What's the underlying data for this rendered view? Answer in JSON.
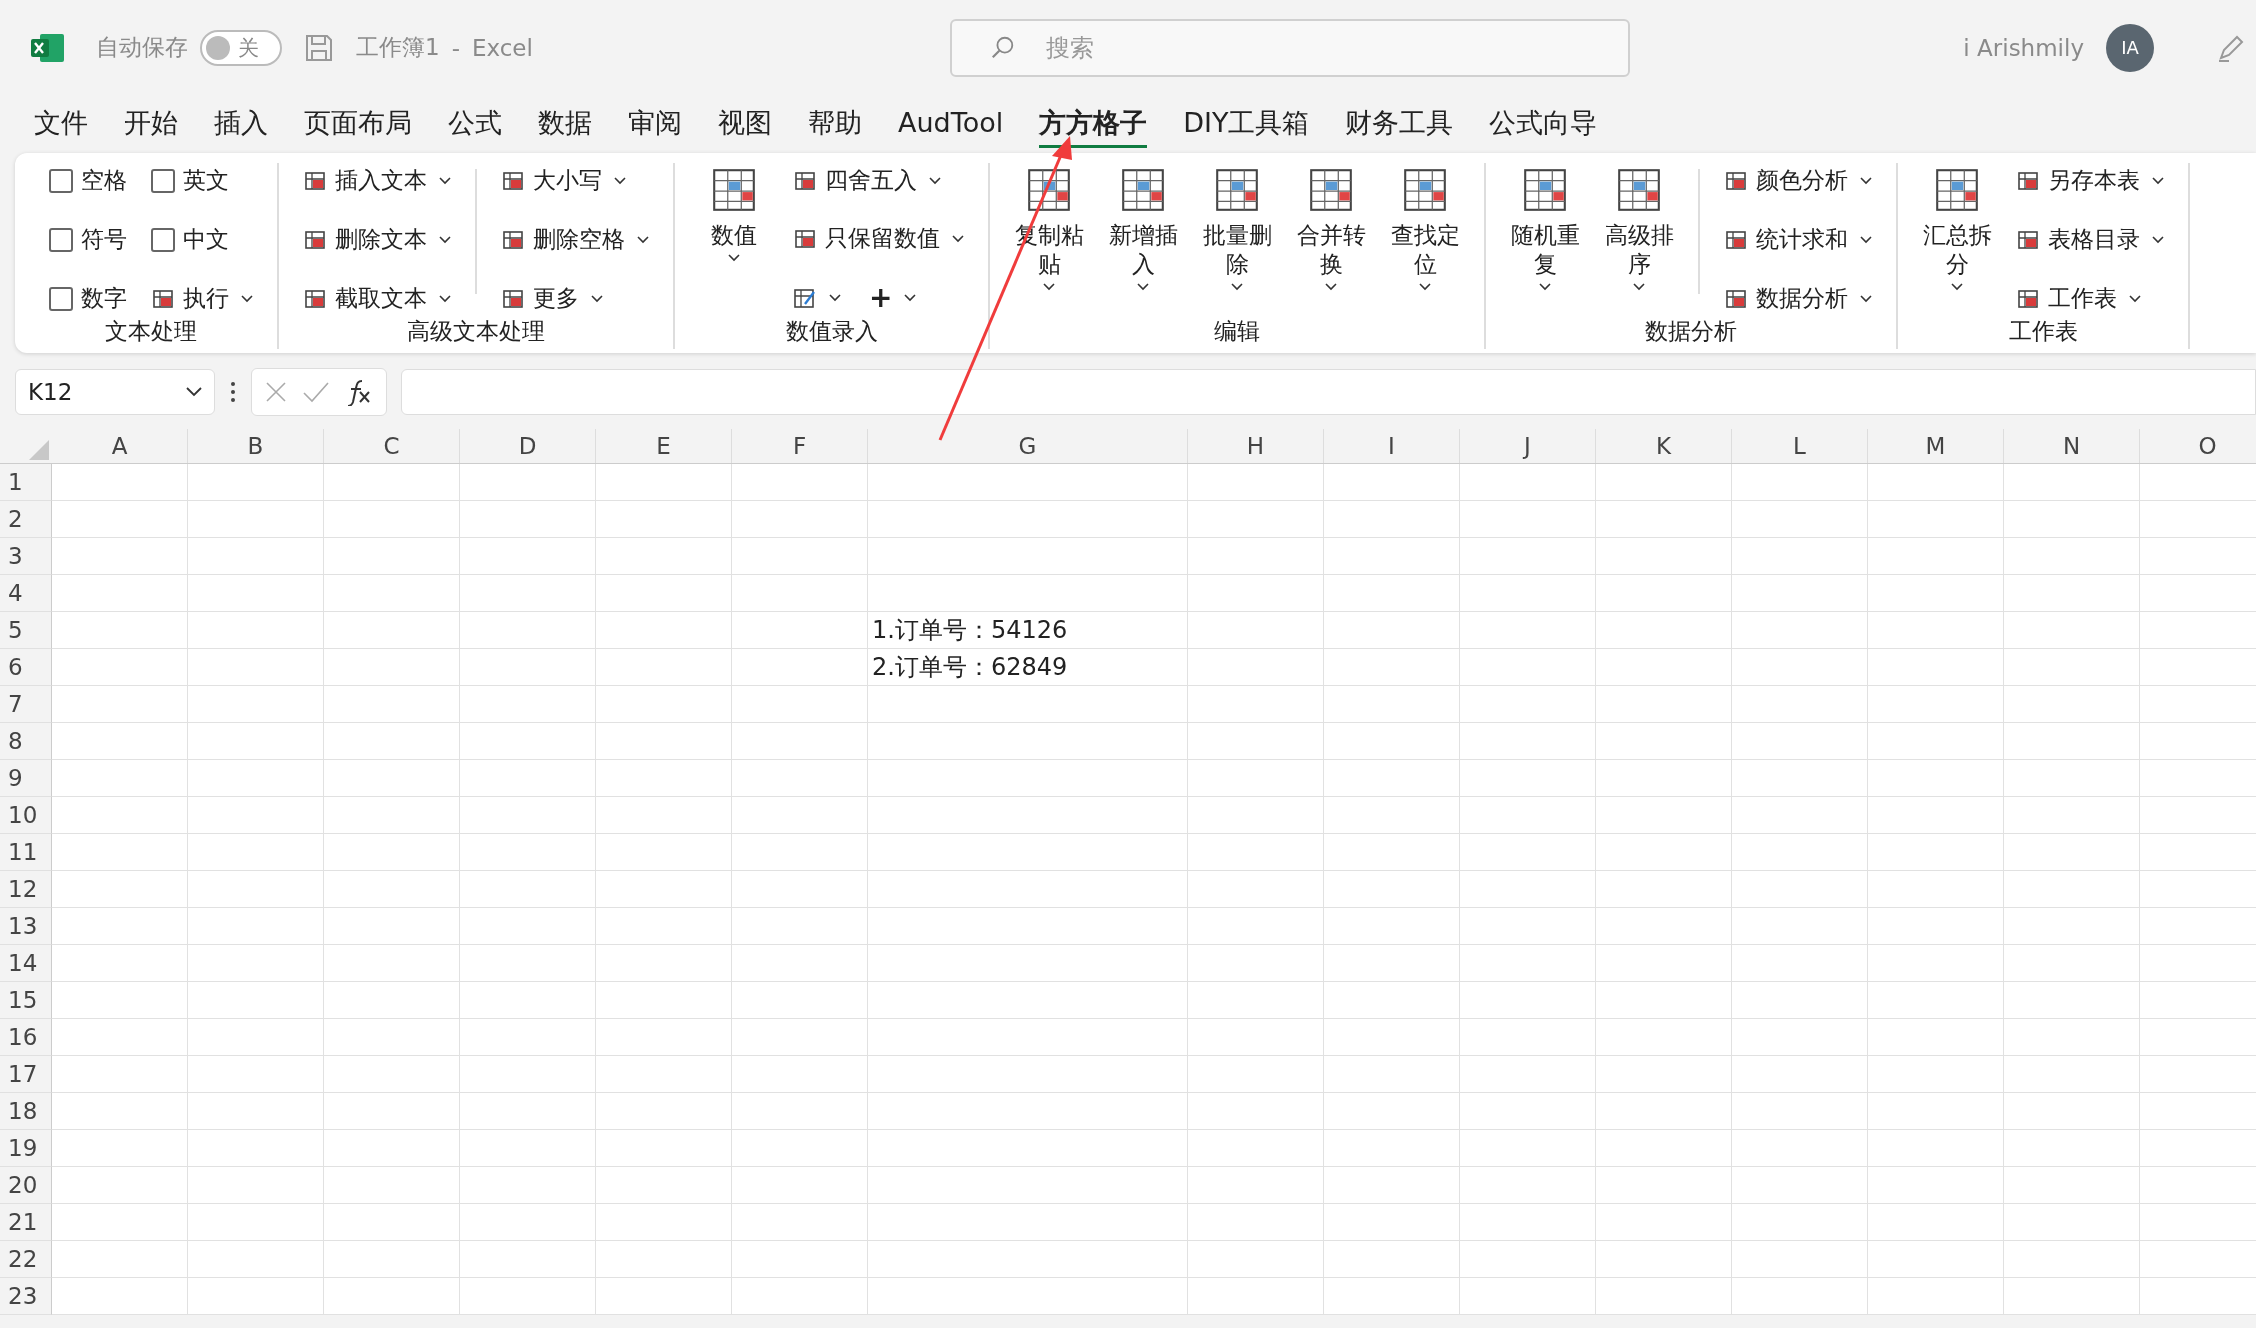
{
  "title_bar": {
    "autosave_label": "自动保存",
    "autosave_toggle": {
      "on": false,
      "label": "关"
    },
    "document": "工作簿1",
    "separator": "-",
    "app": "Excel",
    "search": {
      "placeholder": "搜索"
    },
    "user": "i Arishmily",
    "avatar": "IA"
  },
  "menu_tabs": [
    {
      "label": "文件",
      "selected": false
    },
    {
      "label": "开始",
      "selected": false
    },
    {
      "label": "插入",
      "selected": false
    },
    {
      "label": "页面布局",
      "selected": false
    },
    {
      "label": "公式",
      "selected": false
    },
    {
      "label": "数据",
      "selected": false
    },
    {
      "label": "审阅",
      "selected": false
    },
    {
      "label": "视图",
      "selected": false
    },
    {
      "label": "帮助",
      "selected": false
    },
    {
      "label": "AudTool",
      "selected": false
    },
    {
      "label": "方方格子",
      "selected": true
    },
    {
      "label": "DIY工具箱",
      "selected": false
    },
    {
      "label": "财务工具",
      "selected": false
    },
    {
      "label": "公式向导",
      "selected": false
    }
  ],
  "ribbon": {
    "groups": [
      {
        "label": "文本处理",
        "columns": [
          {
            "divided": false,
            "items": [
              {
                "kind": "checkbox",
                "label": "空格",
                "checked": false
              },
              {
                "kind": "checkbox",
                "label": "符号",
                "checked": false
              },
              {
                "kind": "checkbox",
                "label": "数字",
                "checked": false
              }
            ]
          },
          {
            "divided": false,
            "items": [
              {
                "kind": "checkbox",
                "label": "英文",
                "checked": false
              },
              {
                "kind": "checkbox",
                "label": "中文",
                "checked": false
              },
              {
                "kind": "small",
                "label": "执行"
              }
            ]
          }
        ]
      },
      {
        "label": "高级文本处理",
        "columns": [
          {
            "divided": false,
            "items": [
              {
                "kind": "small",
                "label": "插入文本"
              },
              {
                "kind": "small",
                "label": "删除文本"
              },
              {
                "kind": "small",
                "label": "截取文本"
              }
            ]
          },
          {
            "divided": true,
            "items": [
              {
                "kind": "small",
                "label": "大小写"
              },
              {
                "kind": "small",
                "label": "删除空格"
              },
              {
                "kind": "small",
                "label": "更多"
              }
            ]
          }
        ]
      },
      {
        "label": "数值录入",
        "columns": [
          {
            "divided": false,
            "items": [
              {
                "kind": "large",
                "label": "数值"
              }
            ]
          },
          {
            "divided": false,
            "items": [
              {
                "kind": "small",
                "label": "四舍五入"
              },
              {
                "kind": "small",
                "label": "只保留数值"
              },
              {
                "kind": "row",
                "items": [
                  {
                    "kind": "icon"
                  },
                  {
                    "kind": "glyph",
                    "label": "+"
                  }
                ]
              }
            ]
          }
        ]
      },
      {
        "label": "编辑",
        "columns": [
          {
            "divided": false,
            "items": [
              {
                "kind": "large",
                "label": "复制粘贴"
              }
            ]
          },
          {
            "divided": false,
            "items": [
              {
                "kind": "large",
                "label": "新增插入"
              }
            ]
          },
          {
            "divided": false,
            "items": [
              {
                "kind": "large",
                "label": "批量删除"
              }
            ]
          },
          {
            "divided": false,
            "items": [
              {
                "kind": "large",
                "label": "合并转换"
              }
            ]
          },
          {
            "divided": false,
            "items": [
              {
                "kind": "large",
                "label": "查找定位"
              }
            ]
          }
        ]
      },
      {
        "label": "数据分析",
        "columns": [
          {
            "divided": false,
            "items": [
              {
                "kind": "large",
                "label": "随机重复"
              }
            ]
          },
          {
            "divided": false,
            "items": [
              {
                "kind": "large",
                "label": "高级排序"
              }
            ]
          },
          {
            "divided": true,
            "items": [
              {
                "kind": "small",
                "label": "颜色分析"
              },
              {
                "kind": "small",
                "label": "统计求和"
              },
              {
                "kind": "small",
                "label": "数据分析"
              }
            ]
          }
        ]
      },
      {
        "label": "工作表",
        "columns": [
          {
            "divided": false,
            "items": [
              {
                "kind": "large",
                "label": "汇总拆分"
              }
            ]
          },
          {
            "divided": false,
            "items": [
              {
                "kind": "small",
                "label": "另存本表"
              },
              {
                "kind": "small",
                "label": "表格目录"
              },
              {
                "kind": "small",
                "label": "工作表"
              }
            ]
          }
        ]
      }
    ]
  },
  "formula_bar": {
    "name_box": "K12"
  },
  "sheet": {
    "columns": [
      "A",
      "B",
      "C",
      "D",
      "E",
      "F",
      "G",
      "H",
      "I",
      "J",
      "K",
      "L",
      "M",
      "N",
      "O"
    ],
    "rows": [
      {
        "header": "1"
      },
      {
        "header": "2"
      },
      {
        "header": "3"
      },
      {
        "header": "4"
      },
      {
        "header": "5",
        "cells": [
          null,
          null,
          null,
          null,
          null,
          null,
          "1.订单号：54126"
        ]
      },
      {
        "header": "6",
        "cells": [
          null,
          null,
          null,
          null,
          null,
          null,
          "2.订单号：62849"
        ]
      },
      {
        "header": "7"
      },
      {
        "header": "8"
      },
      {
        "header": "9"
      },
      {
        "header": "10"
      },
      {
        "header": "11"
      },
      {
        "header": "12"
      },
      {
        "header": "13"
      },
      {
        "header": "14"
      },
      {
        "header": "15"
      },
      {
        "header": "16"
      },
      {
        "header": "17"
      },
      {
        "header": "18"
      },
      {
        "header": "19"
      },
      {
        "header": "20"
      },
      {
        "header": "21"
      },
      {
        "header": "22"
      },
      {
        "header": "23"
      }
    ]
  }
}
